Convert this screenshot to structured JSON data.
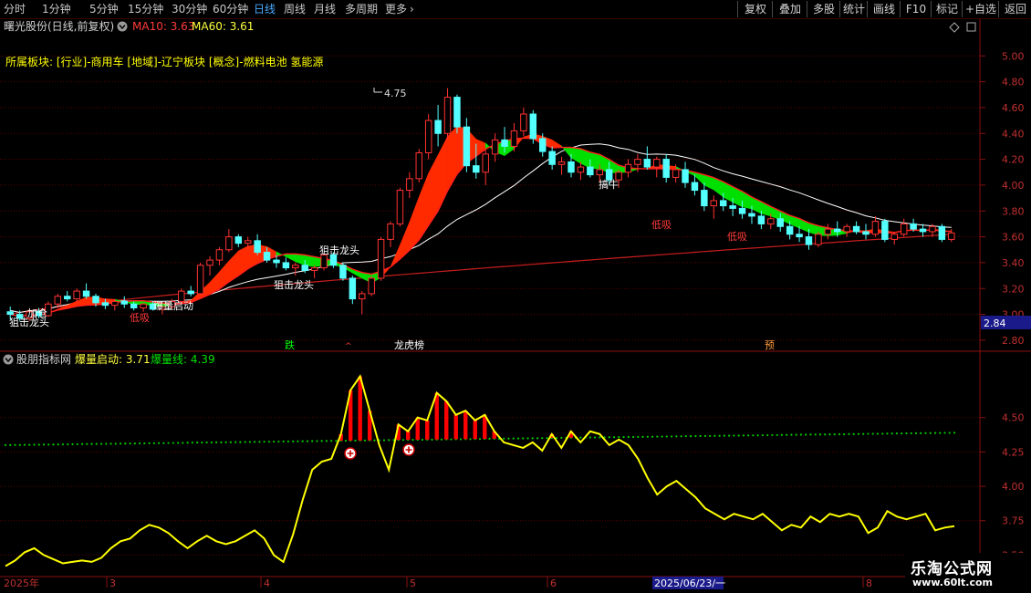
{
  "toolbar": {
    "periods": [
      "分时",
      "1分钟",
      "5分钟",
      "15分钟",
      "30分钟",
      "60分钟",
      "日线",
      "周线",
      "月线",
      "多周期",
      "更多"
    ],
    "active_period": "日线",
    "more_arrow": "chevron-right-icon",
    "right_buttons": [
      "复权",
      "叠加",
      "多股",
      "统计",
      "画线",
      "F10",
      "标记",
      "+自选",
      "返回"
    ]
  },
  "main_panel": {
    "stock_title": "曙光股份(日线,前复权)",
    "ma10_label": "MA10: 3.63",
    "ma60_label": "MA60: 3.61",
    "sector_line": "所属板块: [行业]-商用车 [地域]-辽宁板块 [概念]-燃料电池 氢能源",
    "high_marker": "4.75",
    "price_tag": "2.84",
    "annotations": [
      "加仓",
      "狙击龙头",
      "低吸",
      "爆量启动",
      "狙击龙头",
      "狙击龙头",
      "低吸",
      "搞牛",
      "低吸",
      "低吸"
    ],
    "event_tags": [
      "跌",
      "龙虎榜",
      "预"
    ]
  },
  "indicator_panel": {
    "title": "股朋指标网",
    "line1_label": "爆量启动: 3.71",
    "line2_label": "爆量线: 4.39"
  },
  "date_axis": {
    "labels": [
      "2025年",
      "3",
      "4",
      "5",
      "6",
      "2025/06/23/一",
      "8"
    ]
  },
  "colors": {
    "up": "#ff3232",
    "down": "#54ffff",
    "ma10": "#ffffff",
    "ma60": "#c81e1e",
    "ribbon_up": "#ff2a00",
    "ribbon_down": "#00e000",
    "indicator_line": "#ffff00",
    "indicator_dotted": "#00cc00",
    "grid": "#5a0000",
    "axis_label": "#c03030",
    "active": "#4aa8ff"
  },
  "watermark": {
    "name": "乐淘公式网",
    "url": "www.60lt.com"
  },
  "chart_data": [
    {
      "type": "candlestick",
      "title": "曙光股份(日线,前复权)",
      "y_ticks": [
        5.0,
        4.8,
        4.6,
        4.4,
        4.2,
        4.0,
        3.8,
        3.6,
        3.4,
        3.2,
        3.0,
        2.8
      ],
      "ylim": [
        2.75,
        5.15
      ],
      "series": [
        {
          "name": "MA10",
          "last": 3.63
        },
        {
          "name": "MA60",
          "last": 3.61
        }
      ],
      "ohlc": [
        [
          3.02,
          3.06,
          2.96,
          3.0
        ],
        [
          3.0,
          3.03,
          2.95,
          2.97
        ],
        [
          2.97,
          3.04,
          2.95,
          3.02
        ],
        [
          3.02,
          3.05,
          2.97,
          2.99
        ],
        [
          2.99,
          3.1,
          2.98,
          3.08
        ],
        [
          3.08,
          3.16,
          3.05,
          3.14
        ],
        [
          3.14,
          3.18,
          3.1,
          3.12
        ],
        [
          3.12,
          3.2,
          3.08,
          3.18
        ],
        [
          3.18,
          3.24,
          3.12,
          3.14
        ],
        [
          3.14,
          3.16,
          3.06,
          3.09
        ],
        [
          3.09,
          3.12,
          3.04,
          3.07
        ],
        [
          3.07,
          3.12,
          3.03,
          3.1
        ],
        [
          3.1,
          3.14,
          3.05,
          3.08
        ],
        [
          3.08,
          3.1,
          3.03,
          3.05
        ],
        [
          3.05,
          3.09,
          3.02,
          3.08
        ],
        [
          3.08,
          3.1,
          3.03,
          3.04
        ],
        [
          3.04,
          3.07,
          3.0,
          3.06
        ],
        [
          3.06,
          3.12,
          3.04,
          3.1
        ],
        [
          3.1,
          3.2,
          3.08,
          3.18
        ],
        [
          3.18,
          3.22,
          3.14,
          3.16
        ],
        [
          3.16,
          3.4,
          3.15,
          3.38
        ],
        [
          3.38,
          3.45,
          3.3,
          3.42
        ],
        [
          3.42,
          3.52,
          3.38,
          3.5
        ],
        [
          3.5,
          3.66,
          3.48,
          3.6
        ],
        [
          3.6,
          3.62,
          3.52,
          3.55
        ],
        [
          3.55,
          3.6,
          3.5,
          3.57
        ],
        [
          3.57,
          3.62,
          3.46,
          3.48
        ],
        [
          3.48,
          3.52,
          3.4,
          3.42
        ],
        [
          3.42,
          3.46,
          3.36,
          3.4
        ],
        [
          3.4,
          3.44,
          3.34,
          3.36
        ],
        [
          3.36,
          3.4,
          3.3,
          3.38
        ],
        [
          3.38,
          3.42,
          3.32,
          3.34
        ],
        [
          3.34,
          3.38,
          3.28,
          3.36
        ],
        [
          3.36,
          3.48,
          3.34,
          3.46
        ],
        [
          3.46,
          3.48,
          3.36,
          3.38
        ],
        [
          3.38,
          3.4,
          3.26,
          3.28
        ],
        [
          3.28,
          3.3,
          3.08,
          3.12
        ],
        [
          3.12,
          3.18,
          3.0,
          3.16
        ],
        [
          3.16,
          3.3,
          3.14,
          3.28
        ],
        [
          3.28,
          3.6,
          3.26,
          3.58
        ],
        [
          3.58,
          3.72,
          3.52,
          3.7
        ],
        [
          3.7,
          3.98,
          3.68,
          3.96
        ],
        [
          3.96,
          4.1,
          3.9,
          4.05
        ],
        [
          4.05,
          4.28,
          4.02,
          4.25
        ],
        [
          4.25,
          4.55,
          4.2,
          4.5
        ],
        [
          4.5,
          4.62,
          4.3,
          4.4
        ],
        [
          4.4,
          4.75,
          4.35,
          4.68
        ],
        [
          4.68,
          4.7,
          4.4,
          4.45
        ],
        [
          4.45,
          4.52,
          4.1,
          4.15
        ],
        [
          4.15,
          4.32,
          4.05,
          4.1
        ],
        [
          4.1,
          4.28,
          4.0,
          4.24
        ],
        [
          4.24,
          4.4,
          4.18,
          4.35
        ],
        [
          4.35,
          4.45,
          4.25,
          4.3
        ],
        [
          4.3,
          4.48,
          4.26,
          4.42
        ],
        [
          4.42,
          4.6,
          4.38,
          4.55
        ],
        [
          4.55,
          4.58,
          4.32,
          4.36
        ],
        [
          4.36,
          4.4,
          4.22,
          4.26
        ],
        [
          4.26,
          4.3,
          4.12,
          4.16
        ],
        [
          4.16,
          4.22,
          4.08,
          4.18
        ],
        [
          4.18,
          4.24,
          4.06,
          4.1
        ],
        [
          4.1,
          4.18,
          4.04,
          4.14
        ],
        [
          4.14,
          4.2,
          4.06,
          4.08
        ],
        [
          4.08,
          4.16,
          4.02,
          4.12
        ],
        [
          4.12,
          4.18,
          4.0,
          4.04
        ],
        [
          4.04,
          4.12,
          3.98,
          4.1
        ],
        [
          4.1,
          4.2,
          4.06,
          4.16
        ],
        [
          4.16,
          4.24,
          4.1,
          4.2
        ],
        [
          4.2,
          4.3,
          4.12,
          4.14
        ],
        [
          4.14,
          4.22,
          4.06,
          4.2
        ],
        [
          4.2,
          4.24,
          4.02,
          4.06
        ],
        [
          4.06,
          4.16,
          4.02,
          4.12
        ],
        [
          4.12,
          4.18,
          3.98,
          4.02
        ],
        [
          4.02,
          4.08,
          3.92,
          3.96
        ],
        [
          3.96,
          4.02,
          3.8,
          3.84
        ],
        [
          3.84,
          3.92,
          3.74,
          3.88
        ],
        [
          3.88,
          3.94,
          3.8,
          3.84
        ],
        [
          3.84,
          3.9,
          3.76,
          3.82
        ],
        [
          3.82,
          3.88,
          3.74,
          3.78
        ],
        [
          3.78,
          3.84,
          3.7,
          3.76
        ],
        [
          3.76,
          3.8,
          3.66,
          3.7
        ],
        [
          3.7,
          3.78,
          3.66,
          3.74
        ],
        [
          3.74,
          3.78,
          3.64,
          3.68
        ],
        [
          3.68,
          3.72,
          3.58,
          3.62
        ],
        [
          3.62,
          3.68,
          3.56,
          3.6
        ],
        [
          3.6,
          3.66,
          3.5,
          3.54
        ],
        [
          3.54,
          3.64,
          3.52,
          3.62
        ],
        [
          3.62,
          3.7,
          3.58,
          3.66
        ],
        [
          3.66,
          3.72,
          3.6,
          3.64
        ],
        [
          3.64,
          3.7,
          3.6,
          3.68
        ],
        [
          3.68,
          3.72,
          3.62,
          3.64
        ],
        [
          3.64,
          3.7,
          3.58,
          3.62
        ],
        [
          3.62,
          3.76,
          3.6,
          3.72
        ],
        [
          3.72,
          3.74,
          3.56,
          3.58
        ],
        [
          3.58,
          3.64,
          3.54,
          3.62
        ],
        [
          3.62,
          3.74,
          3.6,
          3.7
        ],
        [
          3.7,
          3.74,
          3.64,
          3.66
        ],
        [
          3.66,
          3.7,
          3.6,
          3.64
        ],
        [
          3.64,
          3.7,
          3.6,
          3.68
        ],
        [
          3.68,
          3.7,
          3.56,
          3.58
        ],
        [
          3.58,
          3.66,
          3.56,
          3.63
        ]
      ]
    },
    {
      "type": "line",
      "title": "股朋指标网",
      "y_ticks": [
        4.5,
        4.25,
        4.0,
        3.75,
        3.5
      ],
      "ylim": [
        3.37,
        4.87
      ],
      "series": [
        {
          "name": "爆量启动",
          "values": [
            3.42,
            3.46,
            3.52,
            3.55,
            3.5,
            3.47,
            3.44,
            3.45,
            3.46,
            3.45,
            3.48,
            3.55,
            3.6,
            3.62,
            3.68,
            3.72,
            3.7,
            3.66,
            3.6,
            3.55,
            3.6,
            3.64,
            3.6,
            3.58,
            3.6,
            3.64,
            3.68,
            3.62,
            3.5,
            3.45,
            3.65,
            3.9,
            4.12,
            4.18,
            4.2,
            4.38,
            4.7,
            4.8,
            4.55,
            4.3,
            4.12,
            4.45,
            4.4,
            4.5,
            4.48,
            4.68,
            4.62,
            4.52,
            4.55,
            4.48,
            4.52,
            4.4,
            4.32,
            4.3,
            4.28,
            4.32,
            4.26,
            4.38,
            4.28,
            4.4,
            4.32,
            4.4,
            4.38,
            4.3,
            4.34,
            4.3,
            4.2,
            4.06,
            3.94,
            4.0,
            4.04,
            3.98,
            3.92,
            3.84,
            3.8,
            3.76,
            3.8,
            3.78,
            3.76,
            3.8,
            3.74,
            3.68,
            3.72,
            3.7,
            3.78,
            3.74,
            3.8,
            3.78,
            3.8,
            3.78,
            3.66,
            3.7,
            3.82,
            3.78,
            3.76,
            3.78,
            3.8,
            3.68,
            3.7,
            3.71
          ]
        },
        {
          "name": "爆量线",
          "last": 4.39,
          "start": 4.3
        }
      ]
    }
  ]
}
